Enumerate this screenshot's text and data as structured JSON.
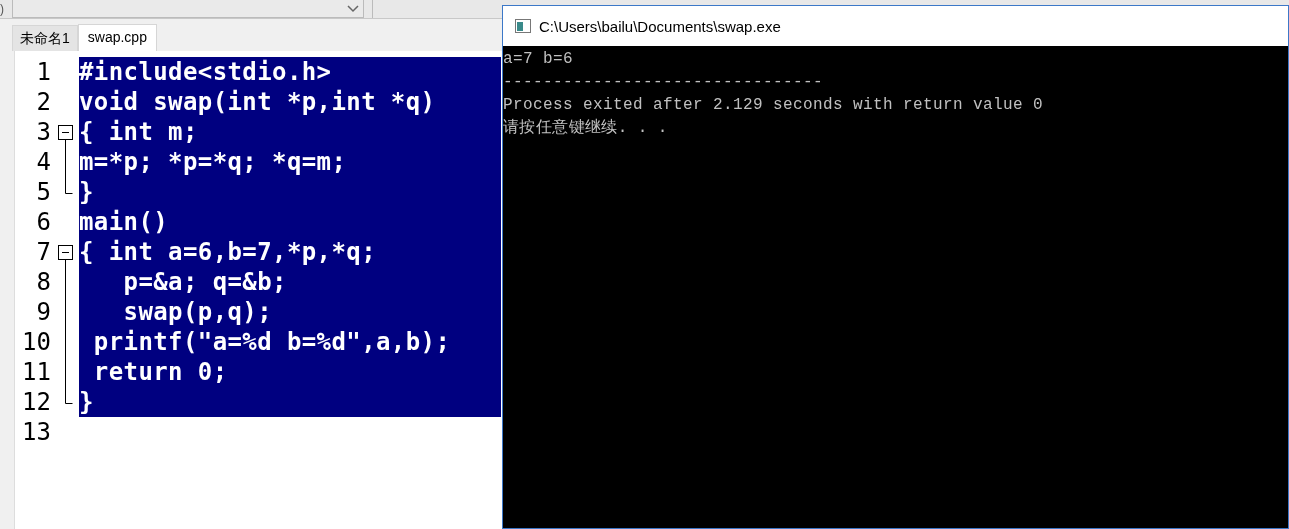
{
  "toolbar": {
    "fragment": ")"
  },
  "tabs": [
    {
      "label": "未命名1",
      "selected": false
    },
    {
      "label": "swap.cpp",
      "selected": true
    }
  ],
  "editor": {
    "lines": [
      {
        "number": "1",
        "code": "#include<stdio.h>",
        "selected": true,
        "kind": "plain"
      },
      {
        "number": "2",
        "code": "void swap(int *p,int *q)",
        "selected": true,
        "kind": "plain"
      },
      {
        "number": "3",
        "code": "{ int m;",
        "selected": true,
        "kind": "fold-start",
        "expanded": true
      },
      {
        "number": "4",
        "code": "m=*p; *p=*q; *q=m;",
        "selected": true,
        "kind": "fold-inside"
      },
      {
        "number": "5",
        "code": "}",
        "selected": true,
        "kind": "fold-end"
      },
      {
        "number": "6",
        "code": "main()",
        "selected": true,
        "kind": "plain"
      },
      {
        "number": "7",
        "code": "{ int a=6,b=7,*p,*q;",
        "selected": true,
        "kind": "fold-start",
        "expanded": true
      },
      {
        "number": "8",
        "code": "   p=&a; q=&b;",
        "selected": true,
        "kind": "fold-inside"
      },
      {
        "number": "9",
        "code": "   swap(p,q);",
        "selected": true,
        "kind": "fold-inside"
      },
      {
        "number": "10",
        "code": " printf(\"a=%d b=%d\",a,b);",
        "selected": true,
        "kind": "fold-inside"
      },
      {
        "number": "11",
        "code": " return 0;",
        "selected": true,
        "kind": "fold-inside"
      },
      {
        "number": "12",
        "code": "}",
        "selected": true,
        "kind": "fold-end"
      },
      {
        "number": "13",
        "selected": false,
        "kind": "plain"
      }
    ]
  },
  "console": {
    "title": "C:\\Users\\bailu\\Documents\\swap.exe",
    "lines": [
      "a=7 b=6",
      "--------------------------------",
      "Process exited after 2.129 seconds with return value 0",
      "请按任意键继续. . ."
    ]
  }
}
